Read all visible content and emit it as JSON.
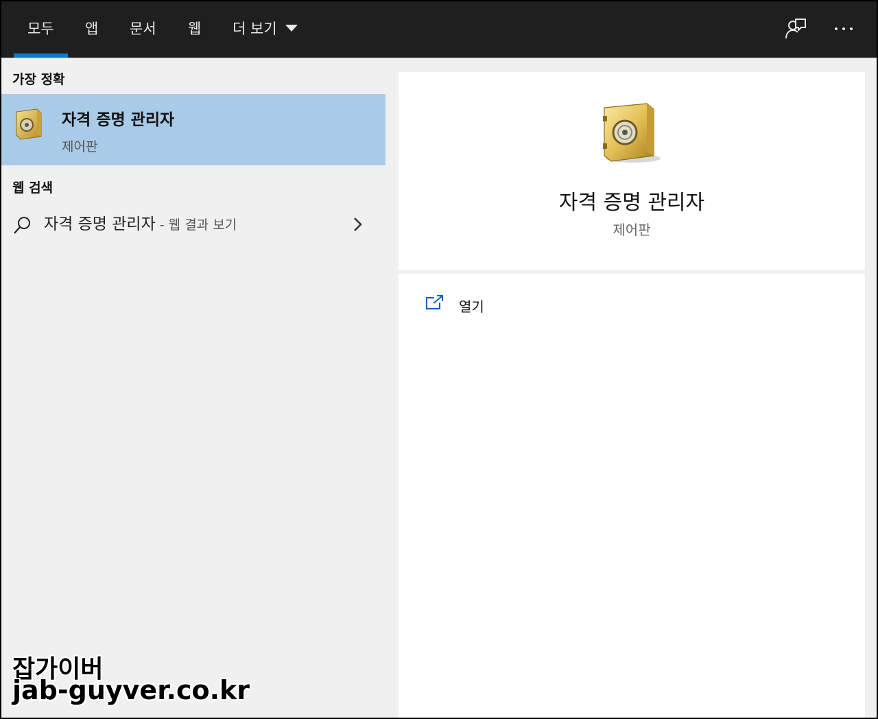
{
  "tabs": [
    {
      "label": "모두",
      "active": true
    },
    {
      "label": "앱"
    },
    {
      "label": "문서"
    },
    {
      "label": "웹"
    },
    {
      "label": "더 보기"
    }
  ],
  "top_icons": [
    "feedback-icon",
    "more-icon"
  ],
  "left": {
    "best_match_header": "가장 정확",
    "best_match": {
      "title": "자격 증명 관리자",
      "subtitle": "제어판",
      "icon": "safe-icon"
    },
    "web_search_header": "웹 검색",
    "web_result": {
      "query": "자격 증명 관리자",
      "hint": " - 웹 결과 보기"
    }
  },
  "right": {
    "title": "자격 증명 관리자",
    "subtitle": "제어판",
    "actions": [
      {
        "label": "열기",
        "icon": "open-external-icon"
      }
    ]
  },
  "watermark": {
    "line1": "잡가이버",
    "line2": "jab-guyver.co.kr"
  },
  "colors": {
    "topbar": "#1f1f1f",
    "accent": "#0a78d7",
    "selected": "#a9cbe8"
  }
}
